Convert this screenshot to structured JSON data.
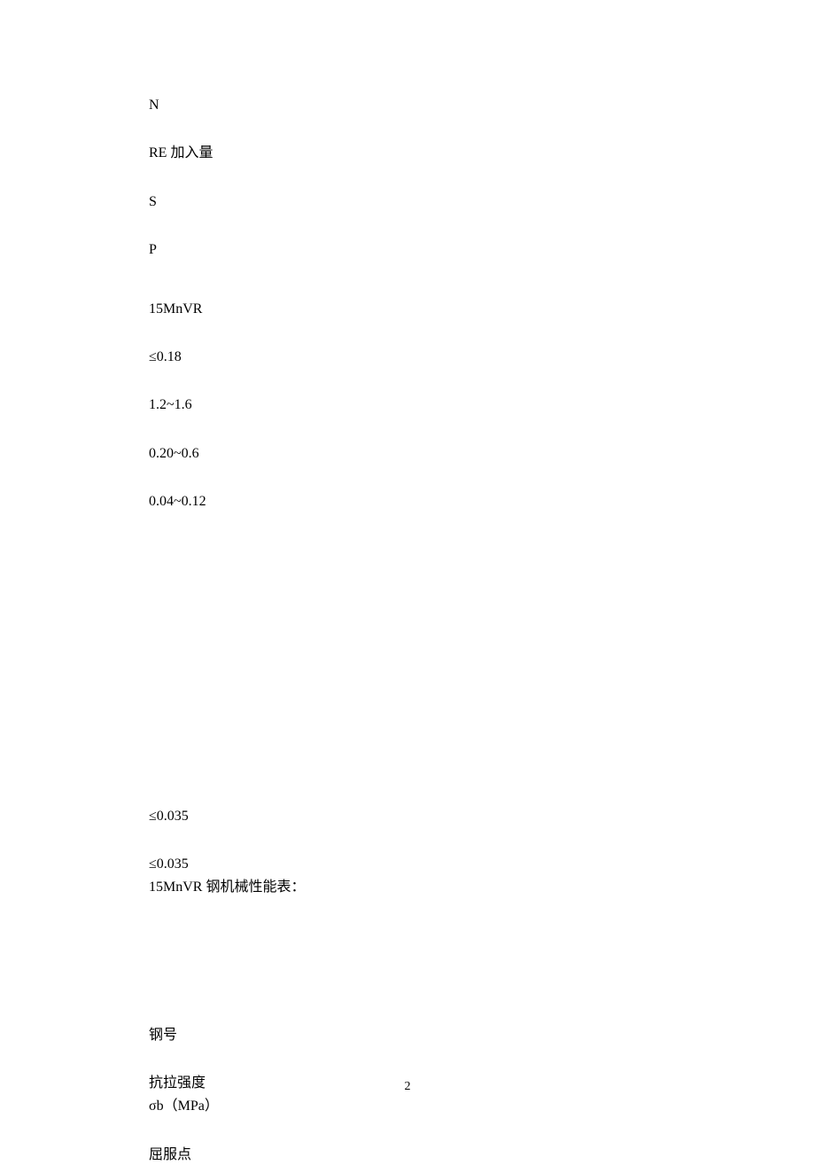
{
  "lines": {
    "n": "N",
    "re": "RE 加入量",
    "s": "S",
    "p": "P",
    "grade": "15MnVR",
    "c_val": "≤0.18",
    "mn_val": "1.2~1.6",
    "si_val": "0.20~0.6",
    "v_val": "0.04~0.12",
    "s_val": "≤0.035",
    "p_val": "≤0.035",
    "mech_title": "15MnVR 钢机械性能表：",
    "col_grade": "钢号",
    "col_tensile_1": "抗拉强度",
    "col_tensile_2": "σb（MPa）",
    "col_yield": "屈服点"
  },
  "page_number": "2"
}
